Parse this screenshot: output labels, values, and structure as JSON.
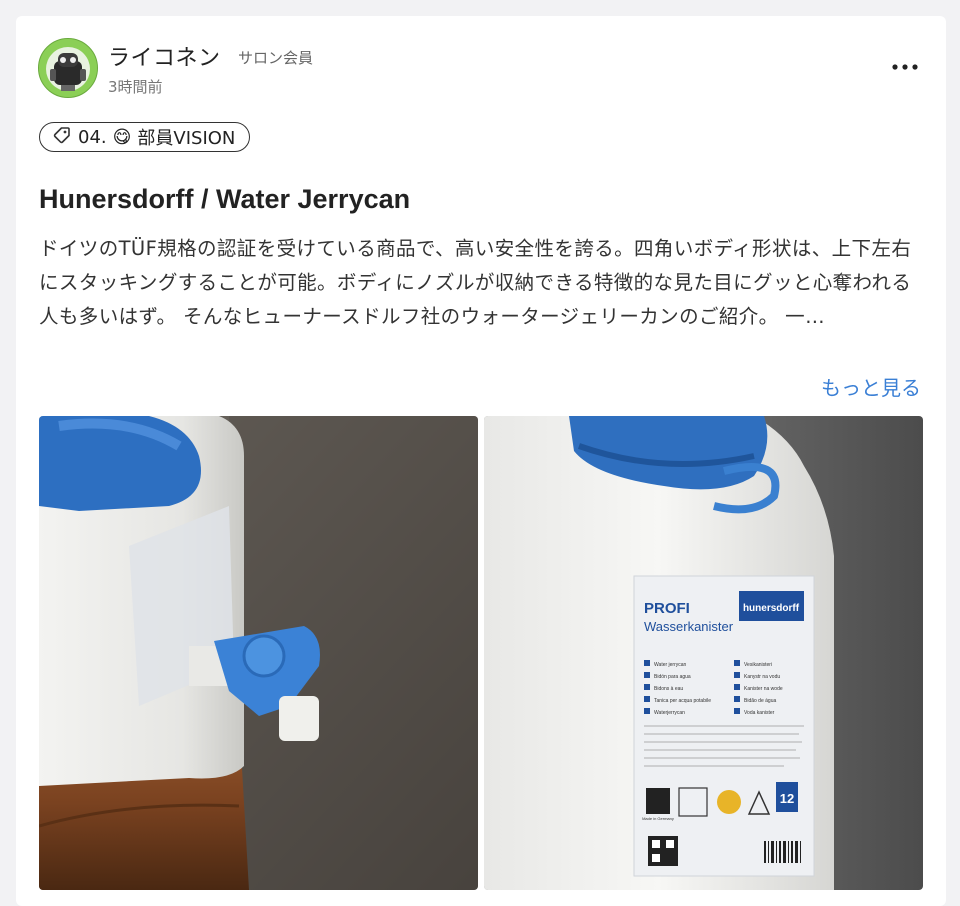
{
  "post": {
    "author": {
      "name": "ライコネン",
      "badge": "サロン会員"
    },
    "time": "3時間前",
    "category": {
      "number": "04.",
      "emoji": "😋",
      "label": "部員VISION"
    },
    "title": "Hunersdorff / Water Jerrycan",
    "body": "ドイツのTÜF規格の認証を受けている商品で、高い安全性を誇る。四角いボディ形状は、上下左右にスタッキングすることが可能。ボディにノズルが収納できる特徴的な見た目にグッと心奪われる人も多いはず。 そんなヒューナースドルフ社のウォータージェリーカンのご紹介。 一…",
    "read_more": "もっと見る"
  },
  "icons": {
    "menu": "more-horizontal-icon",
    "tag": "tag-icon"
  },
  "label": {
    "brand": "hunersdorff",
    "product": "PROFI",
    "subtitle": "Wasserkanister",
    "langs_left": [
      "Water jerrycan",
      "Bidón para agua",
      "Bidons à eau",
      "Tanica per acqua potabile",
      "Waterjerrycan"
    ],
    "langs_right": [
      "Vesikanisteri",
      "Kanystr na vodu",
      "Kanister na wode",
      "Bidão de água",
      "Voda kanister"
    ],
    "capacity": "12",
    "made_in": "Made in Germany"
  },
  "colors": {
    "accent": "#3a7fd5",
    "text": "#222222",
    "avatar": "#7bc34a",
    "cap_blue": "#2f6fbf"
  }
}
